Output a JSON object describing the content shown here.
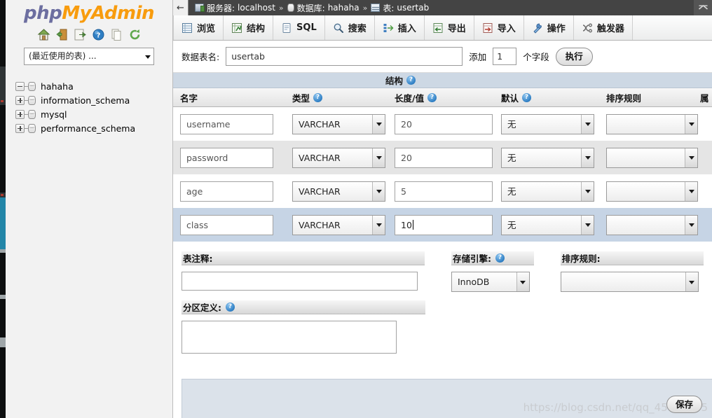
{
  "sidebar": {
    "logo": {
      "part1": "php",
      "part2": "My",
      "part3": "Admin"
    },
    "icons": [
      {
        "name": "home-icon",
        "title": "Home"
      },
      {
        "name": "logout-icon",
        "title": "Log out"
      },
      {
        "name": "export-icon",
        "title": "Export"
      },
      {
        "name": "help-icon",
        "title": "Help"
      },
      {
        "name": "docs-icon",
        "title": "Documentation"
      },
      {
        "name": "reload-icon",
        "title": "Reload"
      }
    ],
    "recent_select": "(最近使用的表) ...",
    "databases": [
      {
        "label": "hahaha",
        "expanded": true
      },
      {
        "label": "information_schema",
        "expanded": false
      },
      {
        "label": "mysql",
        "expanded": false
      },
      {
        "label": "performance_schema",
        "expanded": false
      }
    ]
  },
  "breadcrumb": {
    "back_label": "←",
    "server_label": "服务器:",
    "server_value": "localhost",
    "db_label": "数据库:",
    "db_value": "hahaha",
    "table_label": "表:",
    "table_value": "usertab",
    "separator": "»"
  },
  "tabs": [
    {
      "label": "浏览",
      "icon": "browse-icon",
      "active": false
    },
    {
      "label": "结构",
      "icon": "structure-icon",
      "active": false
    },
    {
      "label": "SQL",
      "icon": "sql-icon",
      "active": false
    },
    {
      "label": "搜索",
      "icon": "search-icon",
      "active": false
    },
    {
      "label": "插入",
      "icon": "insert-icon",
      "active": false
    },
    {
      "label": "导出",
      "icon": "export-icon",
      "active": false
    },
    {
      "label": "导入",
      "icon": "import-icon",
      "active": false
    },
    {
      "label": "操作",
      "icon": "operations-icon",
      "active": false
    },
    {
      "label": "触发器",
      "icon": "triggers-icon",
      "active": false
    }
  ],
  "form": {
    "table_name_label": "数据表名:",
    "table_name_value": "usertab",
    "add_label": "添加",
    "add_count": "1",
    "fields_label": "个字段",
    "go_button": "执行",
    "structure_title": "结构",
    "columns": [
      {
        "label": "名字",
        "help": false
      },
      {
        "label": "类型",
        "help": true
      },
      {
        "label": "长度/值",
        "help": true
      },
      {
        "label": "默认",
        "help": true
      },
      {
        "label": "排序规则",
        "help": false
      },
      {
        "label": "属",
        "help": false
      }
    ],
    "rows": [
      {
        "name": "username",
        "type": "VARCHAR",
        "length": "20",
        "default": "无",
        "collation": "",
        "row_state": "w"
      },
      {
        "name": "password",
        "type": "VARCHAR",
        "length": "20",
        "default": "无",
        "collation": "",
        "row_state": "g"
      },
      {
        "name": "age",
        "type": "VARCHAR",
        "length": "5",
        "default": "无",
        "collation": "",
        "row_state": "w"
      },
      {
        "name": "class",
        "type": "VARCHAR",
        "length": "10",
        "default": "无",
        "collation": "",
        "row_state": "a"
      }
    ]
  },
  "bottom": {
    "comment_label": "表注释:",
    "comment_value": "",
    "engine_label": "存储引擎:",
    "engine_value": "InnoDB",
    "collation_label": "排序规则:",
    "collation_value": "",
    "partition_label": "分区定义:",
    "partition_value": "",
    "save_button": "保存"
  },
  "watermark": "https://blog.csdn.net/qq_45425035",
  "colors": {
    "accent_orange": "#f89c0e",
    "accent_purple": "#6c6ea0",
    "active_row": "#c6d4e5",
    "struct_header": "#cdd8e4",
    "footer_panel": "#dbe2ea"
  }
}
